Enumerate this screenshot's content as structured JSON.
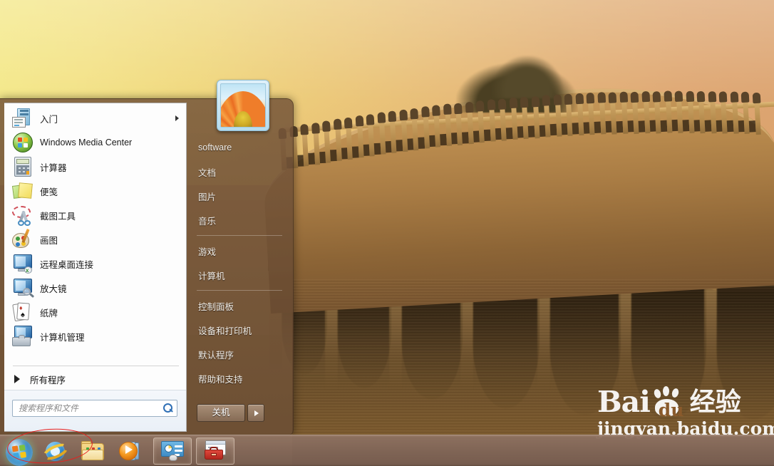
{
  "desktop": {
    "wallpaper_description": "Seventeen-Arch Bridge at Summer Palace, Beijing, at sunset",
    "sky_color_left": "#f4e98a",
    "sky_color_right": "#dca471",
    "water_color": "#5c4427",
    "stone_color": "#bd8e50"
  },
  "watermark": {
    "brand": "Bai",
    "brand_suffix": "du",
    "brand_cn": "经验",
    "url": "jingyan.baidu.com"
  },
  "start_menu": {
    "avatar_name": "user-avatar-flower",
    "left_items": [
      {
        "icon": "getting-started-icon",
        "label": "入门",
        "has_submenu": true
      },
      {
        "icon": "windows-media-center-icon",
        "label": "Windows Media Center",
        "has_submenu": false
      },
      {
        "icon": "calculator-icon",
        "label": "计算器",
        "has_submenu": false
      },
      {
        "icon": "sticky-notes-icon",
        "label": "便笺",
        "has_submenu": false
      },
      {
        "icon": "snipping-tool-icon",
        "label": "截图工具",
        "has_submenu": false
      },
      {
        "icon": "paint-icon",
        "label": "画图",
        "has_submenu": false
      },
      {
        "icon": "remote-desktop-icon",
        "label": "远程桌面连接",
        "has_submenu": false
      },
      {
        "icon": "magnifier-icon",
        "label": "放大镜",
        "has_submenu": false
      },
      {
        "icon": "solitaire-icon",
        "label": "纸牌",
        "has_submenu": false
      },
      {
        "icon": "computer-management-icon",
        "label": "计算机管理",
        "has_submenu": false
      }
    ],
    "all_programs_label": "所有程序",
    "search": {
      "placeholder": "搜索程序和文件",
      "value": "",
      "icon": "search-icon"
    },
    "right_items": [
      {
        "label": "software",
        "separator_after": false
      },
      {
        "label": "文档",
        "separator_after": false
      },
      {
        "label": "图片",
        "separator_after": false
      },
      {
        "label": "音乐",
        "separator_after": true
      },
      {
        "label": "游戏",
        "separator_after": false
      },
      {
        "label": "计算机",
        "separator_after": true
      },
      {
        "label": "控制面板",
        "separator_after": false
      },
      {
        "label": "设备和打印机",
        "separator_after": false
      },
      {
        "label": "默认程序",
        "separator_after": false
      },
      {
        "label": "帮助和支持",
        "separator_after": false
      }
    ],
    "shutdown": {
      "label": "关机",
      "arrow_icon": "chevron-right-icon"
    }
  },
  "taskbar": {
    "start_orb": "windows-start-orb",
    "items": [
      {
        "icon": "internet-explorer-icon",
        "state": "pinned"
      },
      {
        "icon": "windows-explorer-folder-icon",
        "state": "pinned"
      },
      {
        "icon": "windows-media-player-icon",
        "state": "pinned"
      },
      {
        "icon": "control-panel-window-icon",
        "state": "open"
      },
      {
        "icon": "toolbox-window-icon",
        "state": "open"
      }
    ]
  },
  "annotation": {
    "type": "red-ellipse-highlight",
    "color": "#e8201f",
    "target": "start-orb-and-internet-explorer"
  }
}
